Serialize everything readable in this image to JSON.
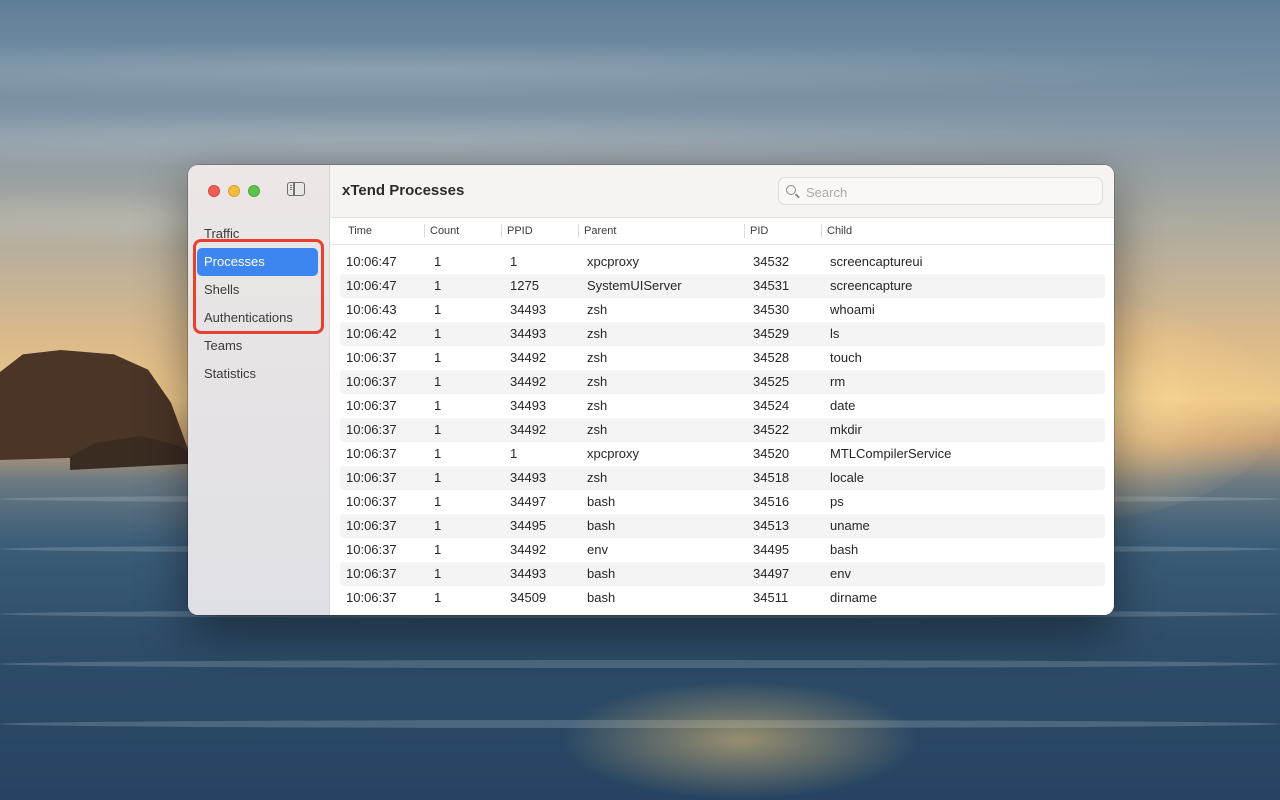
{
  "window": {
    "title": "xTend Processes"
  },
  "sidebar": {
    "items": [
      {
        "label": "Traffic"
      },
      {
        "label": "Processes",
        "selected": true
      },
      {
        "label": "Shells"
      },
      {
        "label": "Authentications"
      },
      {
        "label": "Teams"
      },
      {
        "label": "Statistics"
      }
    ]
  },
  "search": {
    "placeholder": "Search",
    "value": ""
  },
  "table": {
    "columns": [
      "Time",
      "Count",
      "PPID",
      "Parent",
      "PID",
      "Child"
    ],
    "rows": [
      [
        "10:06:47",
        "1",
        "1",
        "xpcproxy",
        "34532",
        "screencaptureui"
      ],
      [
        "10:06:47",
        "1",
        "1275",
        "SystemUIServer",
        "34531",
        "screencapture"
      ],
      [
        "10:06:43",
        "1",
        "34493",
        "zsh",
        "34530",
        "whoami"
      ],
      [
        "10:06:42",
        "1",
        "34493",
        "zsh",
        "34529",
        "ls"
      ],
      [
        "10:06:37",
        "1",
        "34492",
        "zsh",
        "34528",
        "touch"
      ],
      [
        "10:06:37",
        "1",
        "34492",
        "zsh",
        "34525",
        "rm"
      ],
      [
        "10:06:37",
        "1",
        "34493",
        "zsh",
        "34524",
        "date"
      ],
      [
        "10:06:37",
        "1",
        "34492",
        "zsh",
        "34522",
        "mkdir"
      ],
      [
        "10:06:37",
        "1",
        "1",
        "xpcproxy",
        "34520",
        "MTLCompilerService"
      ],
      [
        "10:06:37",
        "1",
        "34493",
        "zsh",
        "34518",
        "locale"
      ],
      [
        "10:06:37",
        "1",
        "34497",
        "bash",
        "34516",
        "ps"
      ],
      [
        "10:06:37",
        "1",
        "34495",
        "bash",
        "34513",
        "uname"
      ],
      [
        "10:06:37",
        "1",
        "34492",
        "env",
        "34495",
        "bash"
      ],
      [
        "10:06:37",
        "1",
        "34493",
        "bash",
        "34497",
        "env"
      ],
      [
        "10:06:37",
        "1",
        "34509",
        "bash",
        "34511",
        "dirname"
      ]
    ]
  },
  "colors": {
    "selection": "#3e86ef",
    "annotation": "#e8402f",
    "close": "#ee5e56",
    "minimize": "#f4bd3f",
    "zoom": "#5ec24b"
  },
  "icons": [
    "close-button",
    "minimize-button",
    "zoom-button",
    "sidebar-toggle-icon",
    "search-icon"
  ]
}
